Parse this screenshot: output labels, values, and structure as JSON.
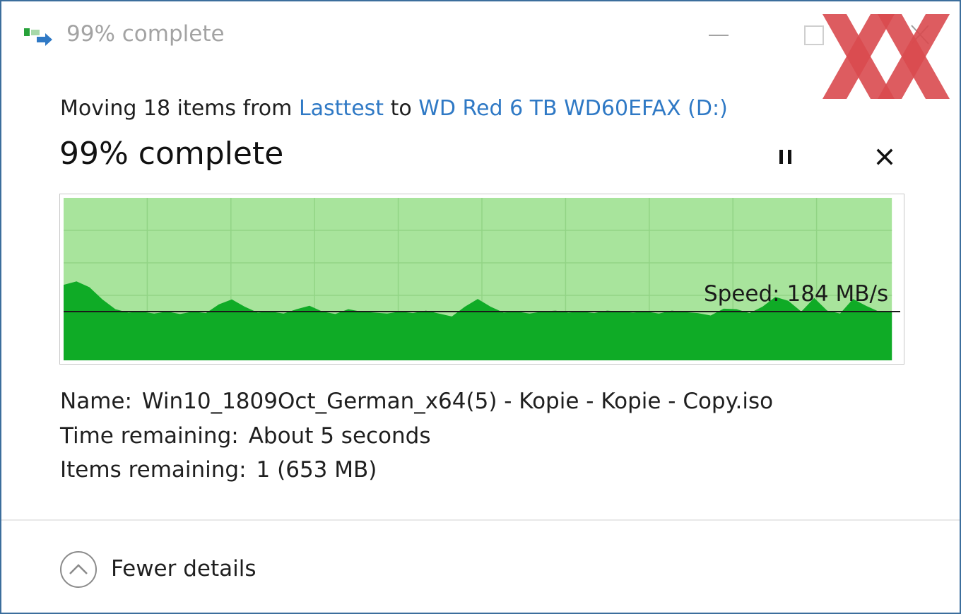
{
  "window": {
    "title": "99% complete",
    "icons": {
      "app": "file-move-icon",
      "minimize": "minimize-icon",
      "maximize": "maximize-icon",
      "close": "close-icon"
    }
  },
  "watermark": {
    "logo": "hardwareluxx-xx-logo",
    "color": "#d94a4f"
  },
  "operation": {
    "prefix": "Moving 18 items from ",
    "source": "Lasttest",
    "connector": " to ",
    "destination": "WD Red 6 TB WD60EFAX (D:)",
    "percent_text": "99% complete",
    "progress_fraction": 0.99
  },
  "controls": {
    "pause_icon": "pause-icon",
    "cancel_icon": "cancel-icon"
  },
  "graph": {
    "speed_text": "Speed: 184 MB/s",
    "current_speed_mb_s": 184,
    "colors": {
      "background": "#a8e49c",
      "grid": "#92d485",
      "fill": "#0fab26",
      "speed_line": "#1a1a1a",
      "border": "#c8c8c8"
    },
    "speed_history_relative": [
      1.55,
      1.62,
      1.5,
      1.25,
      1.05,
      0.98,
      1.0,
      0.96,
      1.0,
      0.95,
      1.0,
      0.97,
      1.15,
      1.25,
      1.1,
      0.98,
      1.0,
      0.96,
      1.05,
      1.12,
      1.0,
      0.95,
      1.05,
      1.0,
      0.98,
      0.96,
      1.0,
      0.97,
      1.02,
      0.96,
      0.9,
      1.1,
      1.26,
      1.1,
      0.98,
      1.0,
      0.96,
      1.0,
      1.02,
      0.98,
      1.0,
      0.97,
      1.02,
      1.0,
      0.98,
      1.0,
      0.96,
      1.02,
      0.99,
      0.97,
      0.92,
      1.06,
      1.05,
      0.97,
      1.1,
      1.3,
      1.22,
      1.0,
      1.28,
      1.02,
      0.96,
      1.26,
      1.12,
      1.0,
      1.0
    ]
  },
  "details": {
    "name_label": "Name:",
    "name_value": "Win10_1809Oct_German_x64(5) - Kopie - Kopie - Copy.iso",
    "time_label": "Time remaining:",
    "time_value": "About 5 seconds",
    "items_label": "Items remaining:",
    "items_value": "1 (653 MB)"
  },
  "footer": {
    "toggle_label": "Fewer details",
    "toggle_icon": "chevron-up-circle-icon"
  }
}
